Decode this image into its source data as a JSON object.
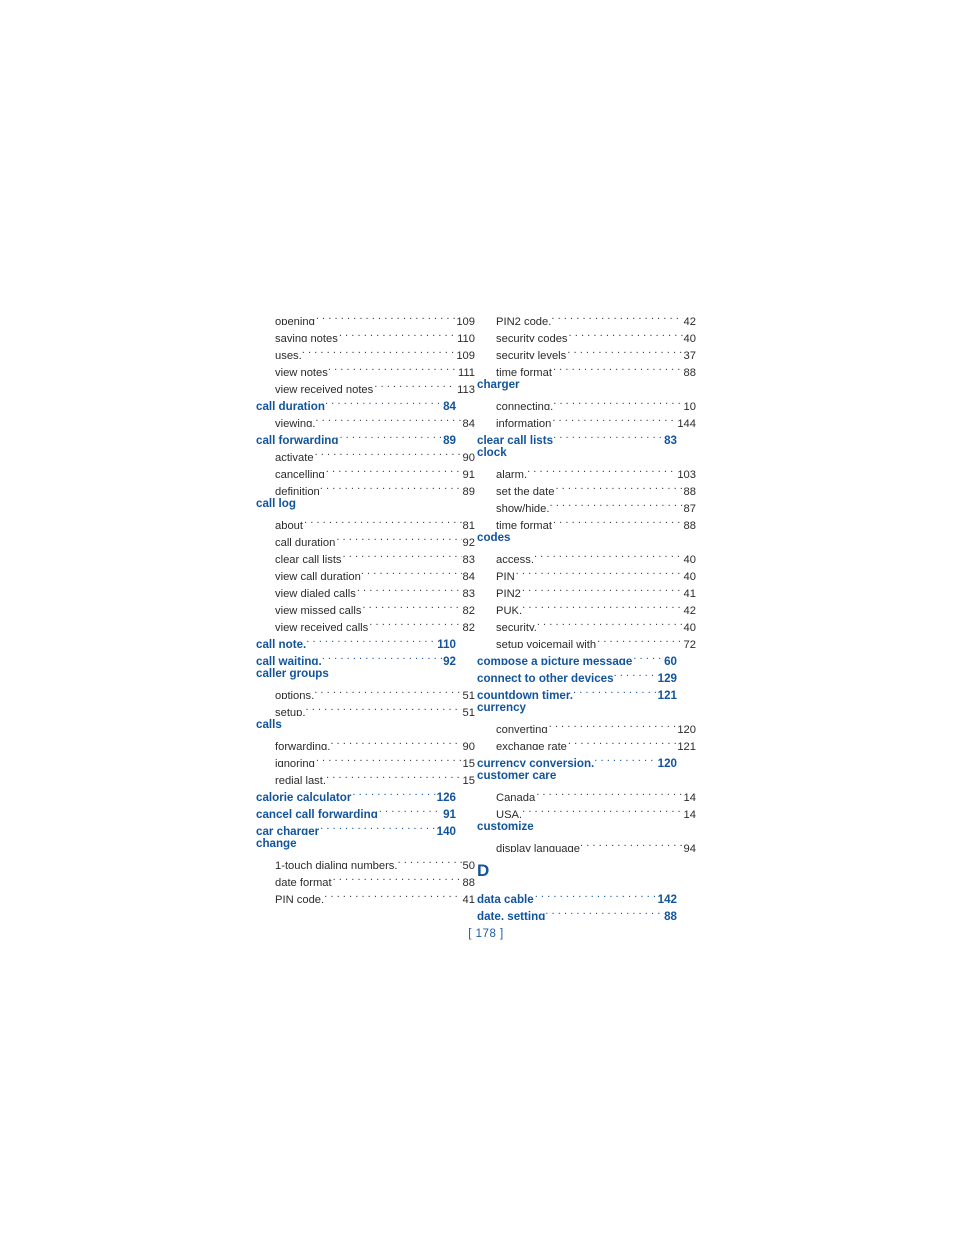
{
  "document": {
    "type": "index",
    "footer_page_number": "[ 178 ]",
    "heading_color": "#12549c",
    "body_color": "#2b2b2b",
    "background_color": "#ffffff"
  },
  "columns": [
    {
      "name": "left-column",
      "entries": [
        {
          "level": "sub",
          "label": "opening",
          "page": "109",
          "tight": false
        },
        {
          "level": "sub",
          "label": "saving notes",
          "page": "110",
          "tight": false
        },
        {
          "level": "sub",
          "label": "uses.",
          "page": "109",
          "tight": true
        },
        {
          "level": "sub",
          "label": "view notes",
          "page": "111",
          "tight": true
        },
        {
          "level": "sub",
          "label": "view received notes",
          "page": "113",
          "tight": false
        },
        {
          "level": "head",
          "label": "call duration",
          "page": "84",
          "tight": true
        },
        {
          "level": "sub",
          "label": "viewing.",
          "page": "84",
          "tight": true
        },
        {
          "level": "head",
          "label": "call forwarding",
          "page": "89",
          "tight": false
        },
        {
          "level": "sub",
          "label": "activate",
          "page": "90",
          "tight": false
        },
        {
          "level": "sub",
          "label": "cancelling",
          "page": "91",
          "tight": false
        },
        {
          "level": "sub",
          "label": "definition",
          "page": "89",
          "tight": true
        },
        {
          "level": "head",
          "label": "call log",
          "page": "",
          "tight": false
        },
        {
          "level": "sub",
          "label": "about",
          "page": "81",
          "tight": false
        },
        {
          "level": "sub",
          "label": "call duration",
          "page": "92",
          "tight": false
        },
        {
          "level": "sub",
          "label": "clear call lists",
          "page": "83",
          "tight": false
        },
        {
          "level": "sub",
          "label": "view call duration",
          "page": "84",
          "tight": true
        },
        {
          "level": "sub",
          "label": "view dialed calls",
          "page": "83",
          "tight": false
        },
        {
          "level": "sub",
          "label": "view missed calls",
          "page": "82",
          "tight": false
        },
        {
          "level": "sub",
          "label": "view received calls",
          "page": "82",
          "tight": false
        },
        {
          "level": "head",
          "label": "call note.",
          "page": "110",
          "tight": true
        },
        {
          "level": "head",
          "label": "call waiting.",
          "page": "92",
          "tight": true
        },
        {
          "level": "head",
          "label": "caller groups",
          "page": "",
          "tight": false
        },
        {
          "level": "sub",
          "label": "options.",
          "page": "51",
          "tight": true
        },
        {
          "level": "sub",
          "label": "setup.",
          "page": "51",
          "tight": true
        },
        {
          "level": "head",
          "label": "calls",
          "page": "",
          "tight": false
        },
        {
          "level": "sub",
          "label": "forwarding.",
          "page": "90",
          "tight": true
        },
        {
          "level": "sub",
          "label": "ignoring",
          "page": "15",
          "tight": false
        },
        {
          "level": "sub",
          "label": "redial last.",
          "page": "15",
          "tight": true
        },
        {
          "level": "head",
          "label": "calorie calculator",
          "page": "126",
          "tight": false
        },
        {
          "level": "head",
          "label": "cancel call forwarding",
          "page": "91",
          "tight": false
        },
        {
          "level": "head",
          "label": "car charger",
          "page": "140",
          "tight": false
        },
        {
          "level": "head",
          "label": "change",
          "page": "",
          "tight": false
        },
        {
          "level": "sub",
          "label": "1-touch dialing numbers.",
          "page": "50",
          "tight": true
        },
        {
          "level": "sub",
          "label": "date format",
          "page": "88",
          "tight": false
        },
        {
          "level": "sub",
          "label": "PIN code.",
          "page": "41",
          "tight": true
        }
      ]
    },
    {
      "name": "right-column",
      "entries": [
        {
          "level": "sub",
          "label": "PIN2 code.",
          "page": "42",
          "tight": true
        },
        {
          "level": "sub",
          "label": "security codes",
          "page": "40",
          "tight": false
        },
        {
          "level": "sub",
          "label": "security levels",
          "page": "37",
          "tight": false
        },
        {
          "level": "sub",
          "label": "time format",
          "page": "88",
          "tight": false
        },
        {
          "level": "head",
          "label": "charger",
          "page": "",
          "tight": false
        },
        {
          "level": "sub",
          "label": "connecting.",
          "page": "10",
          "tight": true
        },
        {
          "level": "sub",
          "label": "information",
          "page": "144",
          "tight": false
        },
        {
          "level": "head",
          "label": "clear call lists",
          "page": "83",
          "tight": true
        },
        {
          "level": "head",
          "label": "clock",
          "page": "",
          "tight": false
        },
        {
          "level": "sub",
          "label": "alarm.",
          "page": "103",
          "tight": true
        },
        {
          "level": "sub",
          "label": "set the date",
          "page": "88",
          "tight": false
        },
        {
          "level": "sub",
          "label": "show/hide.",
          "page": "87",
          "tight": true
        },
        {
          "level": "sub",
          "label": "time format",
          "page": "88",
          "tight": false
        },
        {
          "level": "head",
          "label": "codes",
          "page": "",
          "tight": false
        },
        {
          "level": "sub",
          "label": "access.",
          "page": "40",
          "tight": true
        },
        {
          "level": "sub",
          "label": "PIN",
          "page": "40",
          "tight": false
        },
        {
          "level": "sub",
          "label": "PIN2",
          "page": "41",
          "tight": false
        },
        {
          "level": "sub",
          "label": "PUK.",
          "page": "42",
          "tight": true
        },
        {
          "level": "sub",
          "label": "security.",
          "page": "40",
          "tight": true
        },
        {
          "level": "sub",
          "label": "setup voicemail with",
          "page": "72",
          "tight": false
        },
        {
          "level": "head",
          "label": "compose a picture message",
          "page": "60",
          "tight": false
        },
        {
          "level": "head",
          "label": "connect to other devices",
          "page": "129",
          "tight": true
        },
        {
          "level": "head",
          "label": "countdown timer.",
          "page": "121",
          "tight": true
        },
        {
          "level": "head",
          "label": "currency",
          "page": "",
          "tight": false
        },
        {
          "level": "sub",
          "label": "converting",
          "page": "120",
          "tight": false
        },
        {
          "level": "sub",
          "label": "exchange rate",
          "page": "121",
          "tight": false
        },
        {
          "level": "head",
          "label": "currency conversion.",
          "page": "120",
          "tight": true
        },
        {
          "level": "head",
          "label": "customer care",
          "page": "",
          "tight": false
        },
        {
          "level": "sub",
          "label": "Canada",
          "page": "14",
          "tight": false
        },
        {
          "level": "sub",
          "label": "USA.",
          "page": "14",
          "tight": true
        },
        {
          "level": "head",
          "label": "customize",
          "page": "",
          "tight": false
        },
        {
          "level": "sub",
          "label": "display language",
          "page": "94",
          "tight": true
        },
        {
          "level": "letter",
          "label": "D",
          "page": "",
          "tight": false
        },
        {
          "level": "head",
          "label": "data cable",
          "page": "142",
          "tight": false
        },
        {
          "level": "head",
          "label": "date, setting",
          "page": "88",
          "tight": true
        }
      ]
    }
  ]
}
